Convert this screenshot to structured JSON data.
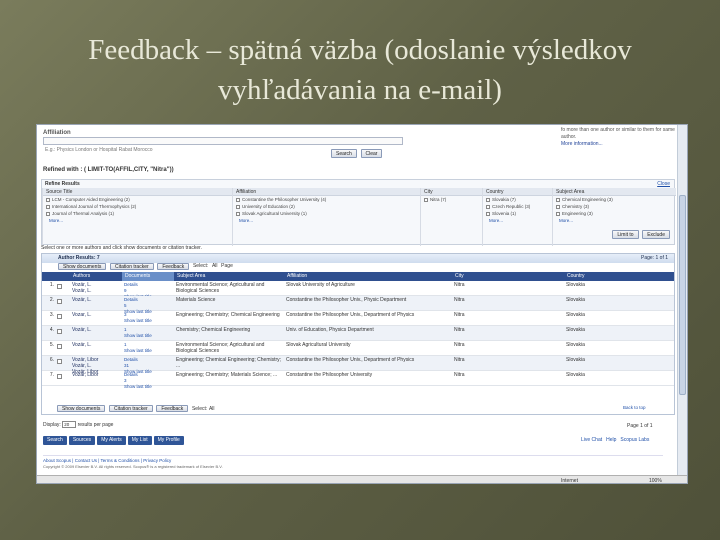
{
  "slide": {
    "title_line1": "Feedback – spätná väzba (odoslanie výsledkov",
    "title_line2": "vyhľadávania na e-mail)"
  },
  "search": {
    "affiliation_label": "Affiliation",
    "affiliation_hint": "E.g.: Physics London or Hospital Rabat Morocco",
    "search_btn": "Search",
    "clear_btn": "Clear",
    "right_note": "fo more than one author or similar to them for same author.",
    "right_link": "More information..."
  },
  "refined": "Refined with : ( LIMIT-TO(AFFIL,CITY, \"Nitra\"))",
  "refine": {
    "title": "Refine Results",
    "close": "Close",
    "columns": [
      {
        "head": "Source Title",
        "items": [
          "LCM - Computer Aided Engineering (2)",
          "International Journal of Thermophysics (2)",
          "Journal of Thermal Analysis (1)"
        ],
        "more": "More..."
      },
      {
        "head": "Affiliation",
        "items": [
          "Constantine the Philosopher University (4)",
          "University of Education (2)",
          "Slovak Agricultural University (1)"
        ],
        "more": "More..."
      },
      {
        "head": "City",
        "items": [
          "Nitra (7)"
        ],
        "more": ""
      },
      {
        "head": "Country",
        "items": [
          "Slovakia (7)",
          "Czech Republic (3)",
          "Slovenia (1)"
        ],
        "more": "More..."
      },
      {
        "head": "Subject Area",
        "items": [
          "Chemical Engineering (3)",
          "Chemistry (3)",
          "Engineering (3)"
        ],
        "more": "More..."
      }
    ],
    "limit_btn": "Limit to",
    "exclude_btn": "Exclude"
  },
  "select_line": "Select one or more authors and click show documents or citation tracker.",
  "results": {
    "title": "Author Results: 7",
    "page": "Page:  1  of 1",
    "show_docs_btn": "Show documents",
    "citation_btn": "Citation tracker",
    "feedback_btn": "Feedback",
    "select_label": "Select:",
    "all_label": "All",
    "page_label": "Page",
    "headers": [
      "Authors",
      "Documents",
      "Subject Area",
      "Affiliation",
      "City",
      "Country"
    ],
    "rows": [
      {
        "num": "1.",
        "author": "Vozár, L.\nVozár, L.",
        "docs": "Details\n9\nShow last title",
        "subject": "Environmental Science; Agricultural and Biological Sciences",
        "affil": "Slovak University of Agriculture",
        "city": "Nitra",
        "country": "Slovakia"
      },
      {
        "num": "2.",
        "author": "Vozár, L.",
        "docs": "Details\n5\nShow last title",
        "subject": "Materials Science",
        "affil": "Constantine the Philosopher Univ., Physic Department",
        "city": "Nitra",
        "country": "Slovakia"
      },
      {
        "num": "3.",
        "author": "Vozar, L.",
        "docs": "3\nShow last title",
        "subject": "Engineering; Chemistry; Chemical Engineering",
        "affil": "Constantine the Philosopher Univ., Department of Physics",
        "city": "Nitra",
        "country": "Slovakia"
      },
      {
        "num": "4.",
        "author": "Vozár, L.",
        "docs": "1\nShow last title",
        "subject": "Chemistry; Chemical Engineering",
        "affil": "Univ. of Education, Physics Department",
        "city": "Nitra",
        "country": "Slovakia"
      },
      {
        "num": "5.",
        "author": "Vozár, L.",
        "docs": "1\nShow last title",
        "subject": "Environmental Science; Agricultural and Biological Sciences",
        "affil": "Slovak Agricultural University",
        "city": "Nitra",
        "country": "Slovakia"
      },
      {
        "num": "6.",
        "author": "Vozár, Libor\nVozár, L.\nVozár, Libor",
        "docs": "Details\n31\nShow last title",
        "subject": "Engineering; Chemical Engineering; Chemistry; ...",
        "affil": "Constantine the Philosopher Univ., Department of Physics",
        "city": "Nitra",
        "country": "Slovakia"
      },
      {
        "num": "7.",
        "author": "Vozár, Libor",
        "docs": "Details\n3\nShow last title",
        "subject": "Engineering; Chemistry; Materials Science; ...",
        "affil": "Constantine the Philosopher University",
        "city": "Nitra",
        "country": "Slovakia"
      }
    ],
    "back_to_top": "Back to top"
  },
  "display": {
    "label": "Display:",
    "value": "20",
    "suffix": "results per page",
    "page_right": "Page  1  of 1"
  },
  "nav": {
    "buttons": [
      "Search",
      "Sources",
      "My Alerts",
      "My List",
      "My Profile"
    ],
    "right": [
      "Live Chat",
      "Help",
      "Scopus Labs"
    ]
  },
  "footer": {
    "links": "About Scopus  |  Contact Us  |  Terms & Conditions  |  Privacy Policy",
    "copyright": "Copyright © 2009 Elsevier B.V. All rights reserved. Scopus® is a registered trademark of Elsevier B.V."
  },
  "status": {
    "internet": "Internet",
    "zoom": "100%"
  }
}
